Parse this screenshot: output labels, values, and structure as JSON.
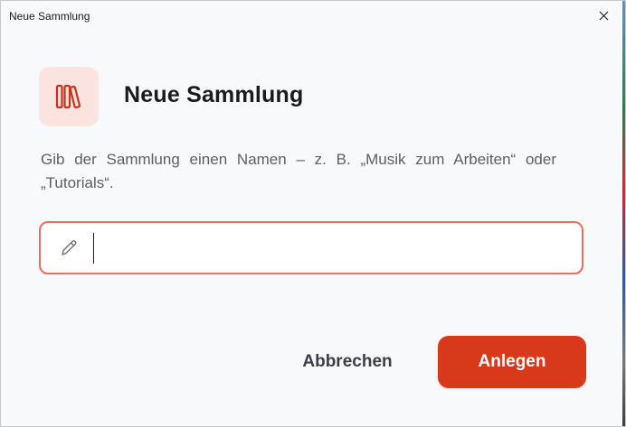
{
  "window": {
    "title": "Neue Sammlung"
  },
  "dialog": {
    "heading": "Neue Sammlung",
    "icon": "books-icon",
    "description": "Gib der Sammlung einen Namen – z. B. „Musik zum Arbeiten“ oder „Tutorials“."
  },
  "name_input": {
    "value": "",
    "placeholder": "",
    "icon": "pencil-icon"
  },
  "actions": {
    "cancel_label": "Abbrechen",
    "create_label": "Anlegen"
  },
  "colors": {
    "accent": "#d9391b",
    "input_border": "#e8705e",
    "icon_bg": "#fbe3e0",
    "icon_stroke": "#c8321c"
  }
}
